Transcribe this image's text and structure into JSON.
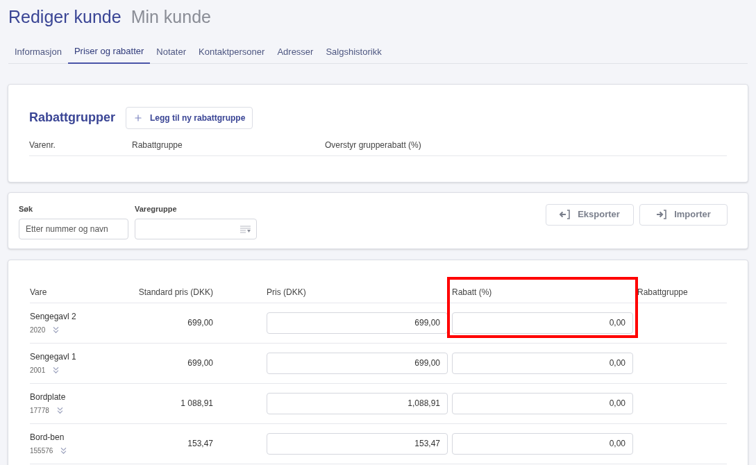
{
  "header": {
    "title": "Rediger kunde",
    "subtitle": "Min kunde"
  },
  "tabs": [
    {
      "label": "Informasjon",
      "selected": false
    },
    {
      "label": "Priser og rabatter",
      "selected": true
    },
    {
      "label": "Notater",
      "selected": false
    },
    {
      "label": "Kontaktpersoner",
      "selected": false
    },
    {
      "label": "Adresser",
      "selected": false
    },
    {
      "label": "Salgshistorikk",
      "selected": false
    }
  ],
  "discount_groups": {
    "title": "Rabattgrupper",
    "add_button": "Legg til ny rabattgruppe",
    "columns": [
      "Varenr.",
      "Rabattgruppe",
      "Overstyr grupperabatt (%)"
    ]
  },
  "filters": {
    "search": {
      "label": "Søk",
      "placeholder": "Etter nummer og navn"
    },
    "product_group": {
      "label": "Varegruppe"
    },
    "buttons": [
      {
        "label": "Eksporter",
        "kind": "export"
      },
      {
        "label": "Importer",
        "kind": "import"
      }
    ]
  },
  "table": {
    "columns": [
      {
        "label": "Vare"
      },
      {
        "label": "Standard pris (DKK)"
      },
      {
        "label": "Pris (DKK)"
      },
      {
        "label": "Rabatt (%)",
        "highlighted": true
      },
      {
        "label": "Rabattgruppe"
      }
    ],
    "rows": [
      {
        "name": "Sengegavl 2",
        "number": "2020",
        "standard_price": "699,00",
        "price": "699,00",
        "discount": "0,00"
      },
      {
        "name": "Sengegavl 1",
        "number": "2001",
        "standard_price": "699,00",
        "price": "699,00",
        "discount": "0,00"
      },
      {
        "name": "Bordplate",
        "number": "17778",
        "standard_price": "1 088,91",
        "price": "1,088,91",
        "discount": "0,00"
      },
      {
        "name": "Bord-ben",
        "number": "155576",
        "standard_price": "153,47",
        "price": "153,47",
        "discount": "0,00"
      }
    ]
  }
}
